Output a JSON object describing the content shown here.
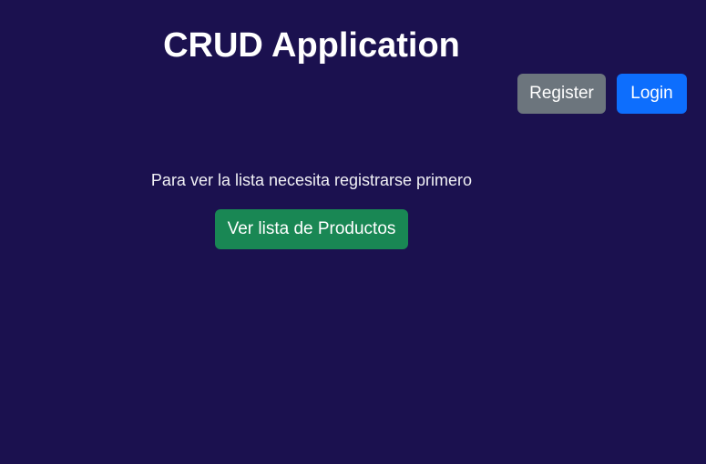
{
  "header": {
    "title": "CRUD Application"
  },
  "nav": {
    "register_label": "Register",
    "login_label": "Login"
  },
  "main": {
    "notice": "Para ver la lista necesita registrarse primero",
    "products_button_label": "Ver lista de Productos"
  },
  "colors": {
    "background": "#1b114f",
    "register_button": "#6c757d",
    "login_button": "#0d6efd",
    "products_button": "#198754",
    "text": "#ffffff"
  }
}
